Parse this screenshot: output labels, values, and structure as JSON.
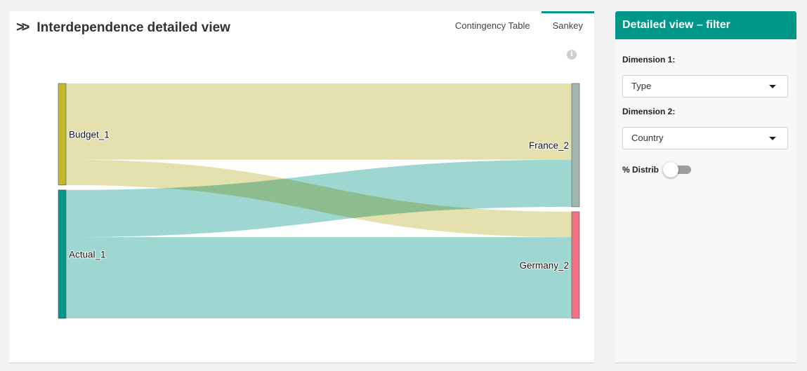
{
  "main": {
    "title": "Interdependence detailed view",
    "title_icon": "double-chevron-right-icon",
    "tabs": [
      {
        "label": "Contingency Table",
        "active": false
      },
      {
        "label": "Sankey",
        "active": true
      }
    ],
    "info_icon": "info-icon",
    "accent_color": "#009688"
  },
  "chart_data": {
    "type": "sankey",
    "nodes": [
      {
        "name": "Budget_1",
        "color": "#c2b82e"
      },
      {
        "name": "Actual_1",
        "color": "#009688"
      },
      {
        "name": "France_2",
        "color": "#a2b6b0"
      },
      {
        "name": "Germany_2",
        "color": "#ee7282"
      }
    ],
    "links": [
      {
        "source": "Budget_1",
        "target": "France_2",
        "value": 105,
        "color": "#e3e0ac"
      },
      {
        "source": "Budget_1",
        "target": "Germany_2",
        "value": 35,
        "color": "#e3e0ac"
      },
      {
        "source": "Actual_1",
        "target": "France_2",
        "value": 65,
        "color": "#9bd6cf"
      },
      {
        "source": "Actual_1",
        "target": "Germany_2",
        "value": 112,
        "color": "#9bd6cf"
      }
    ]
  },
  "sidebar": {
    "header": "Detailed view – filter",
    "dimension1_label": "Dimension 1:",
    "dimension1_value": "Type",
    "dimension2_label": "Dimension 2:",
    "dimension2_value": "Country",
    "toggle_label": "% Distrib",
    "toggle_on": false
  }
}
